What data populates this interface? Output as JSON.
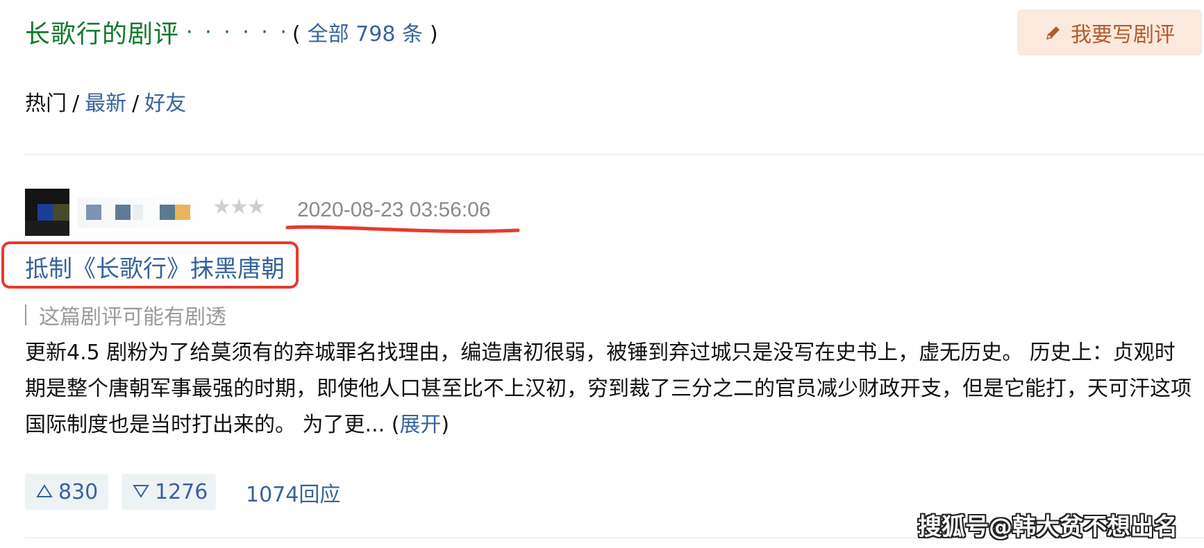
{
  "header": {
    "title": "长歌行的剧评",
    "dots": "· · · · · ·",
    "count_open": "(",
    "count_label": "全部 798 条",
    "count_close": ")",
    "write_button_label": "我要写剧评"
  },
  "sort": {
    "current": "热门",
    "separator": "/",
    "links": [
      "最新",
      "好友"
    ]
  },
  "review": {
    "stars_display": "★★★",
    "timestamp": "2020-08-23 03:56:06",
    "title": "抵制《长歌行》抹黑唐朝",
    "spoiler_note": "这篇剧评可能有剧透",
    "excerpt": "更新4.5 剧粉为了给莫须有的弃城罪名找理由，编造唐初很弱，被锤到弃过城只是没写在史书上，虚无历史。 历史上：贞观时期是整个唐朝军事最强的时期，即使他人口甚至比不上汉初，穷到裁了三分之二的官员减少财政开支，但是它能打，天可汗这项国际制度也是当时打出来的。 为了更...",
    "expand_open": "(",
    "expand_label": "展开",
    "expand_close": ")",
    "useful_count": "830",
    "useless_count": "1276",
    "reply_label": "1074回应"
  },
  "watermark": "搜狐号@韩大贫不想出名",
  "colors": {
    "title_green": "#0f7a2c",
    "link_blue": "#37639b",
    "annotation_red": "#e63a2e",
    "button_bg": "#fbe9dd",
    "button_text": "#b55a2a"
  },
  "icons": {
    "write": "pencil-icon",
    "up": "triangle-up-icon",
    "down": "triangle-down-icon"
  }
}
